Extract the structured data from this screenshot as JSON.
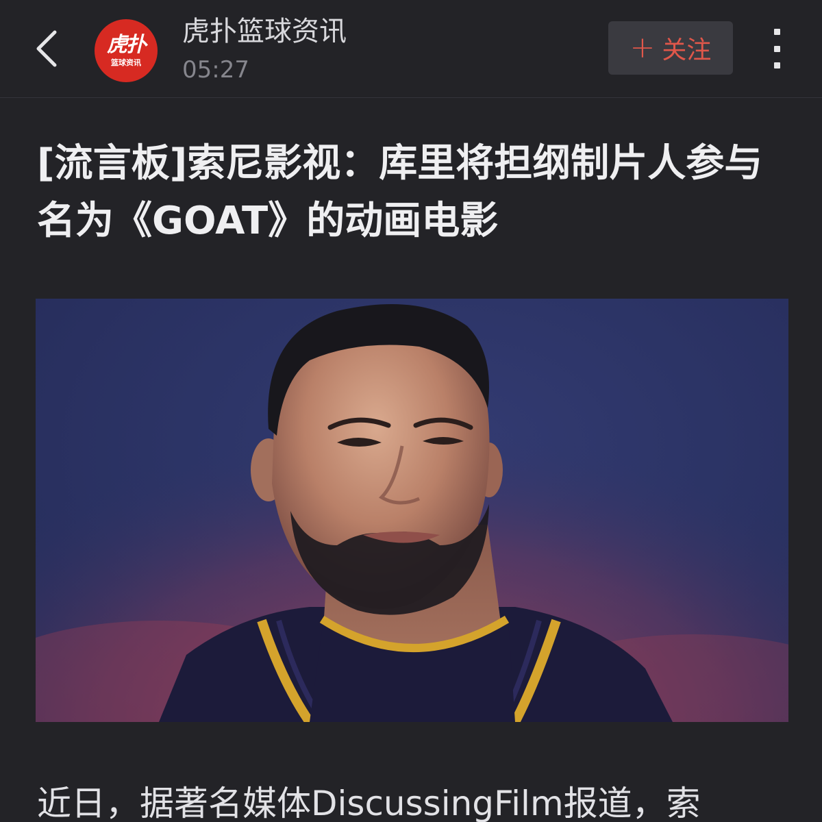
{
  "header": {
    "back_icon": "chevron-left-icon",
    "account_name": "虎扑篮球资讯",
    "publish_time": "05:27",
    "avatar": {
      "main": "虎扑",
      "sub": "篮球资讯",
      "bg_color": "#d72a22"
    },
    "follow_label": "关注",
    "follow_icon": "plus-icon",
    "follow_color": "#e0574a",
    "more_icon": "more-vertical-icon"
  },
  "article": {
    "title": "[流言板]索尼影视：库里将担纲制片人参与名为《GOAT》的动画电影",
    "body_first_line": "近日，据著名媒体DiscussingFilm报道，索"
  },
  "theme": {
    "background": "#232327",
    "text_primary": "#efeff1",
    "text_secondary": "#86868d"
  }
}
